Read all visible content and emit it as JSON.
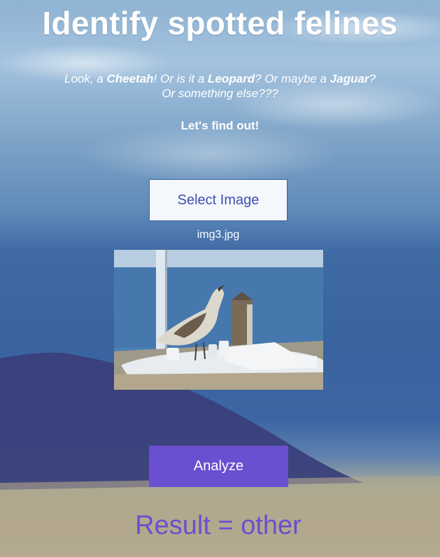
{
  "header": {
    "title": "Identify spotted felines"
  },
  "intro": {
    "part1": "Look, a ",
    "cheetah": "Cheetah",
    "part2": "! Or is it a ",
    "leopard": "Leopard",
    "part3": "? Or maybe a ",
    "jaguar": "Jaguar",
    "part4": "?",
    "line2": "Or something else???",
    "call_to_action": "Let's find out!"
  },
  "upload": {
    "select_label": "Select Image",
    "filename": "img3.jpg"
  },
  "actions": {
    "analyze_label": "Analyze"
  },
  "result": {
    "text": "Result = other"
  },
  "colors": {
    "button_border": "#3f5fa3",
    "select_text": "#3f4fb0",
    "accent": "#6a4fd0"
  }
}
